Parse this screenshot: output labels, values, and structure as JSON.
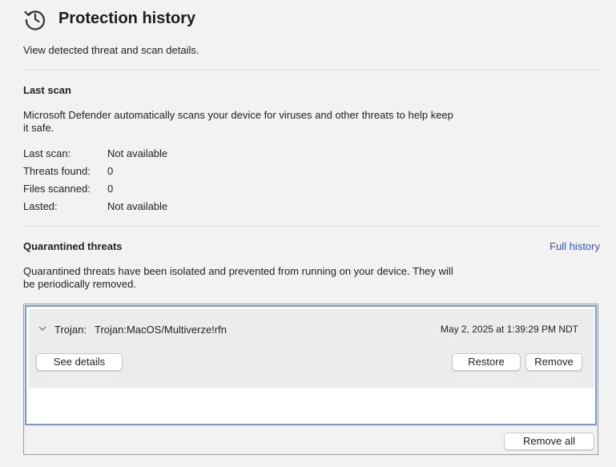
{
  "header": {
    "title": "Protection history",
    "subtitle": "View detected threat and scan details."
  },
  "last_scan": {
    "title": "Last scan",
    "description": "Microsoft Defender automatically scans your device for viruses and other threats to help keep it safe.",
    "rows": [
      {
        "label": "Last scan:",
        "value": "Not available"
      },
      {
        "label": "Threats found:",
        "value": "0"
      },
      {
        "label": "Files scanned:",
        "value": "0"
      },
      {
        "label": "Lasted:",
        "value": "Not available"
      }
    ]
  },
  "quarantine": {
    "title": "Quarantined threats",
    "full_history_label": "Full history",
    "description": "Quarantined threats have been isolated and prevented from running on your device. They will be periodically removed.",
    "items": [
      {
        "type": "Trojan:",
        "name": "Trojan:MacOS/Multiverze!rfn",
        "date": "May 2, 2025 at 1:39:29 PM NDT",
        "see_details_label": "See details",
        "restore_label": "Restore",
        "remove_label": "Remove"
      }
    ],
    "remove_all_label": "Remove all"
  },
  "colors": {
    "background": "#f2f2f2",
    "link": "#2457d6",
    "selection_border": "#7c93e6"
  },
  "icons": {
    "header": "history-clock-icon",
    "expand": "chevron-down-icon"
  }
}
